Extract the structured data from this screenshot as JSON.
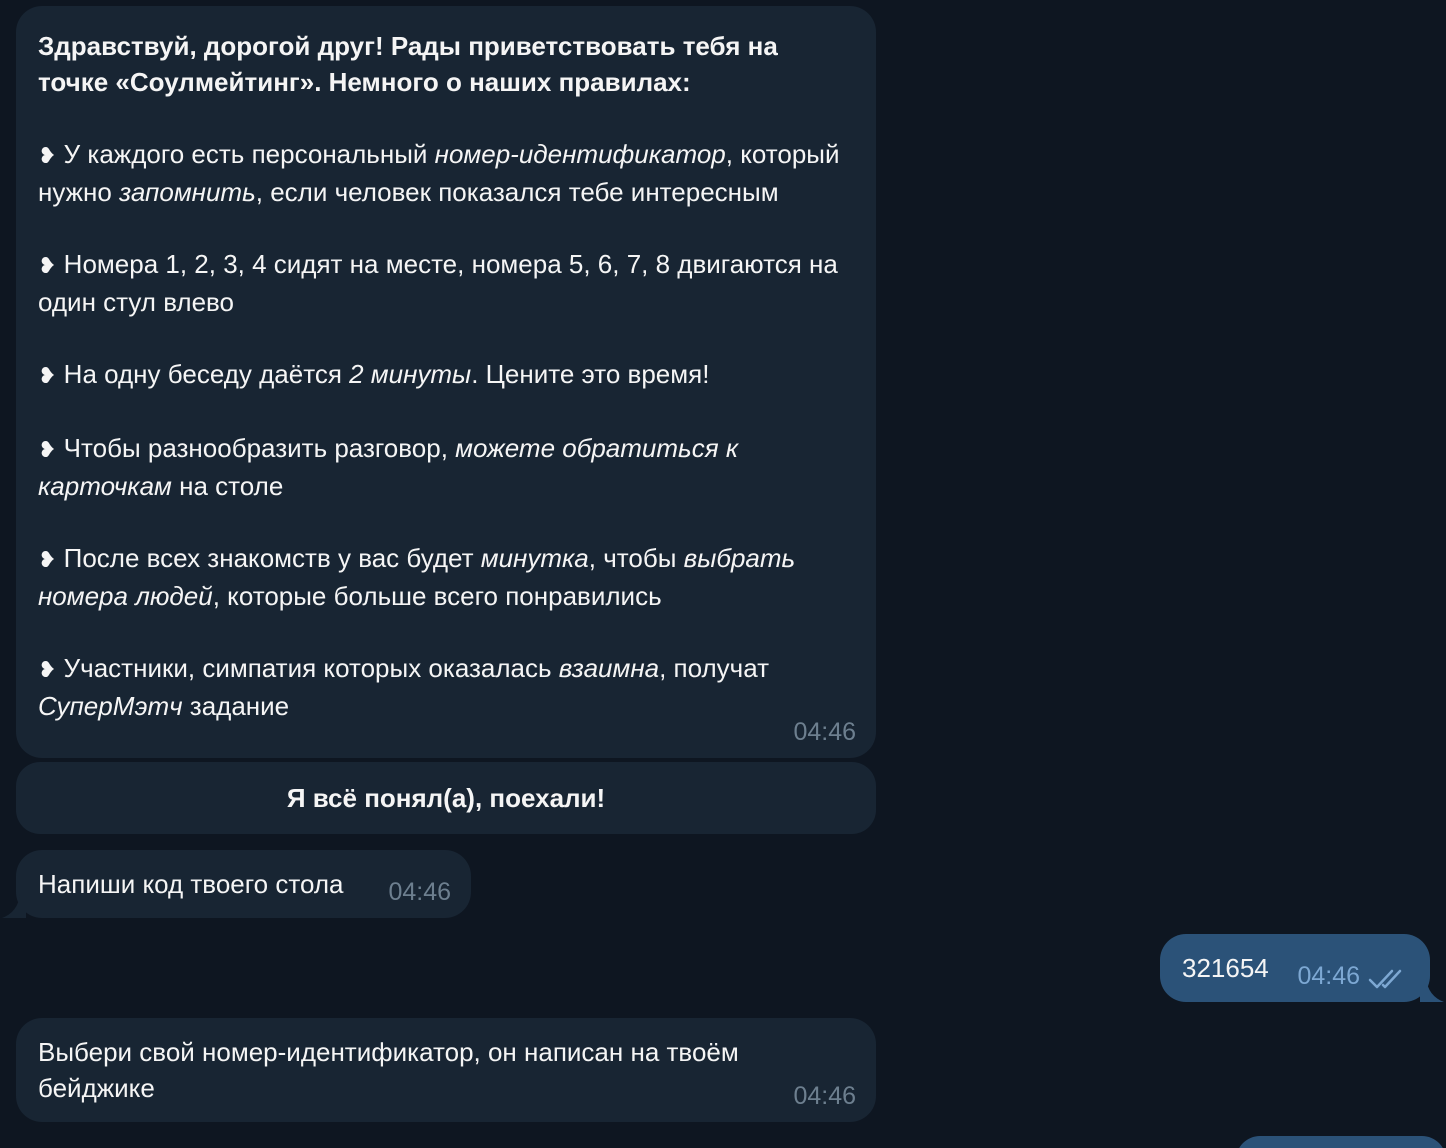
{
  "messages": {
    "rules": {
      "title": "Здравствуй, дорогой друг! Рады приветствовать тебя на точке «Соулмейтинг». Немного о наших правилах:",
      "bullet": "❥",
      "r1_a": " У каждого есть персональный ",
      "r1_b": "номер-идентификатор",
      "r1_c": ", который нужно ",
      "r1_d": "запомнить",
      "r1_e": ", если человек показался тебе интересным",
      "r2_a": " Номера 1, 2, 3, 4 сидят на месте, номера 5, 6, 7, 8 двигаются на один стул влево",
      "r3_a": " На одну беседу даётся ",
      "r3_b": "2 минуты",
      "r3_c": ". Цените это время!",
      "r4_a": " Чтобы разнообразить разговор, ",
      "r4_b": "можете обратиться к карточкам",
      "r4_c": " на столе",
      "r5_a": " После всех знакомств у вас будет ",
      "r5_b": "минутка",
      "r5_c": ", чтобы ",
      "r5_d": "выбрать номера людей",
      "r5_e": ", которые больше всего понравились",
      "r6_a": " Участники, симпатия которых оказалась ",
      "r6_b": "взаимна",
      "r6_c": ", получат ",
      "r6_d": "СуперМэтч",
      "r6_e": " задание",
      "time": "04:46"
    },
    "keyboard_button": "Я всё понял(а), поехали!",
    "ask_code": {
      "text": "Напиши код твоего стола",
      "time": "04:46"
    },
    "user_code": {
      "text": "321654",
      "time": "04:46"
    },
    "ask_id": {
      "text": "Выбери свой номер-идентификатор, он написан на твоём бейджике",
      "time": "04:46"
    }
  },
  "colors": {
    "background": "#0e1621",
    "incoming_bubble": "#182533",
    "outgoing_bubble": "#2b5278",
    "time_incoming": "#6d7f8f",
    "read_ticks": "#7da8d3"
  },
  "icons": {
    "read_status": "double-check-icon"
  }
}
